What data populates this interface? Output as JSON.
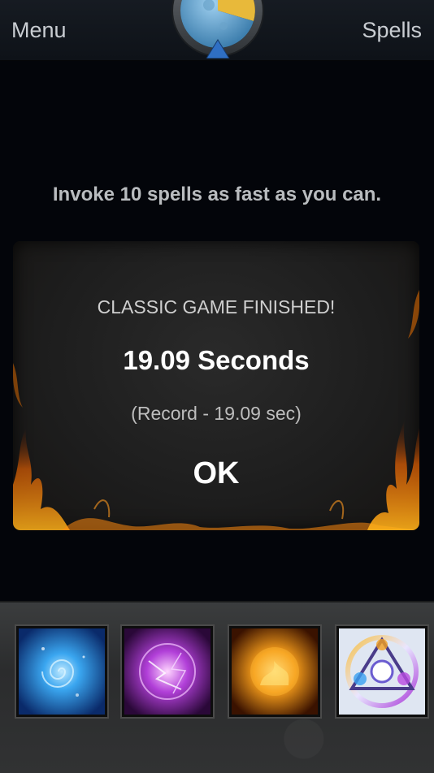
{
  "header": {
    "menu_label": "Menu",
    "spells_label": "Spells",
    "emblem_icon": "day-night-clock-emblem"
  },
  "instruction": "Invoke 10 spells as fast as you can.",
  "dialog": {
    "title": "CLASSIC GAME FINISHED!",
    "time": "19.09 Seconds",
    "record": "(Record - 19.09 sec)",
    "ok_label": "OK"
  },
  "spell_slots": [
    {
      "icon": "quas-ice-orb-icon",
      "color": "#1f8fe0"
    },
    {
      "icon": "wex-storm-orb-icon",
      "color": "#c040e0"
    },
    {
      "icon": "exort-fire-orb-icon",
      "color": "#f08a10"
    },
    {
      "icon": "invoke-sigil-icon",
      "color": "#9aa8ff"
    }
  ],
  "colors": {
    "background": "#03050a",
    "topbar": "#12161c",
    "dialog": "#1f1f1f",
    "fire_accent": "#ff8a00"
  }
}
